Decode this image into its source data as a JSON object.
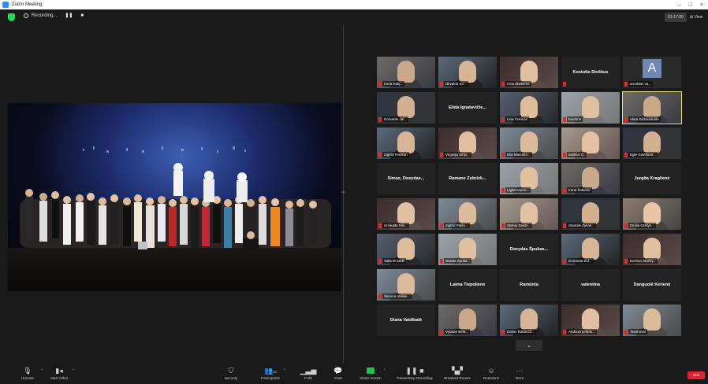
{
  "window": {
    "title": "Zoom Meeting",
    "min": "–",
    "max": "□",
    "close": "×"
  },
  "topbar": {
    "recording": "Recording...",
    "pause": "❚❚",
    "stop": "■",
    "timer": "01:17:30",
    "view": "View"
  },
  "participants": [
    {
      "name": "Irena Kubį..."
    },
    {
      "name": "Ūkvalda Sn..."
    },
    {
      "name": "Irma Žbekiene"
    },
    {
      "name": "Kostutis Stoškus",
      "no_video": true
    },
    {
      "name": "arnoldas va...",
      "avatar": "A"
    },
    {
      "name": "Domante Jal..."
    },
    {
      "name": "Elida Ignatavičie...",
      "no_video": true
    },
    {
      "name": "Lina Čekinas"
    },
    {
      "name": "EveGrin"
    },
    {
      "name": "Alina Dičkauskaite"
    },
    {
      "name": "Zigfrid Pviokan"
    },
    {
      "name": "Virginija Šinju..."
    },
    {
      "name": "Elia Marcelia..."
    },
    {
      "name": "andrius G."
    },
    {
      "name": "Egle Gavrilava..."
    },
    {
      "name": "Simas, Doeydas...",
      "no_video": true
    },
    {
      "name": "Ramane Zubrick...",
      "no_video": true
    },
    {
      "name": "Ligita Ivorno..."
    },
    {
      "name": "Irena Šukiene"
    },
    {
      "name": "Jurgita Kraglienė",
      "no_video": true
    },
    {
      "name": "Urnikaite Mili..."
    },
    {
      "name": "Zigfrid Plaila..."
    },
    {
      "name": "Sūrnaj Žakūs..."
    },
    {
      "name": "Stanislė Žykas..."
    },
    {
      "name": "Emilia Griklys..."
    },
    {
      "name": "Valia M Sūde"
    },
    {
      "name": "Genda Špuka..."
    },
    {
      "name": "Doeydas Špukas...",
      "no_video": true
    },
    {
      "name": "Domante Zul..."
    },
    {
      "name": "Evelina Stanky..."
    },
    {
      "name": "Šimona Valikie..."
    },
    {
      "name": "Laima Tiepoliene",
      "no_video": true
    },
    {
      "name": "Ramūnta",
      "no_video": true
    },
    {
      "name": "valentina",
      "no_video": true
    },
    {
      "name": "Danguolė Kerienė",
      "no_video": true
    },
    {
      "name": "Diana Vaidibalė",
      "no_video": true
    },
    {
      "name": "Vytaute Bela..."
    },
    {
      "name": "Dalius Rakauch..."
    },
    {
      "name": "Andriusrūpėjas..."
    },
    {
      "name": "Tseshuvei"
    }
  ],
  "toolbar": {
    "unmute": "Unmute",
    "start_video": "Start Video",
    "security": "Security",
    "participants": "Participants",
    "participants_count": "40",
    "polls": "Polls",
    "chat": "Chat",
    "share_screen": "Share Screen",
    "pause_recording": "Pause/Stop Recording",
    "breakout": "Breakout Rooms",
    "reactions": "Reactions",
    "more": "More",
    "end": "End"
  },
  "colors": {
    "accent": "#2d8cff",
    "end": "#e0242a",
    "share": "#23c14f",
    "active_speaker": "#e8e07a",
    "mute": "#e02828"
  }
}
